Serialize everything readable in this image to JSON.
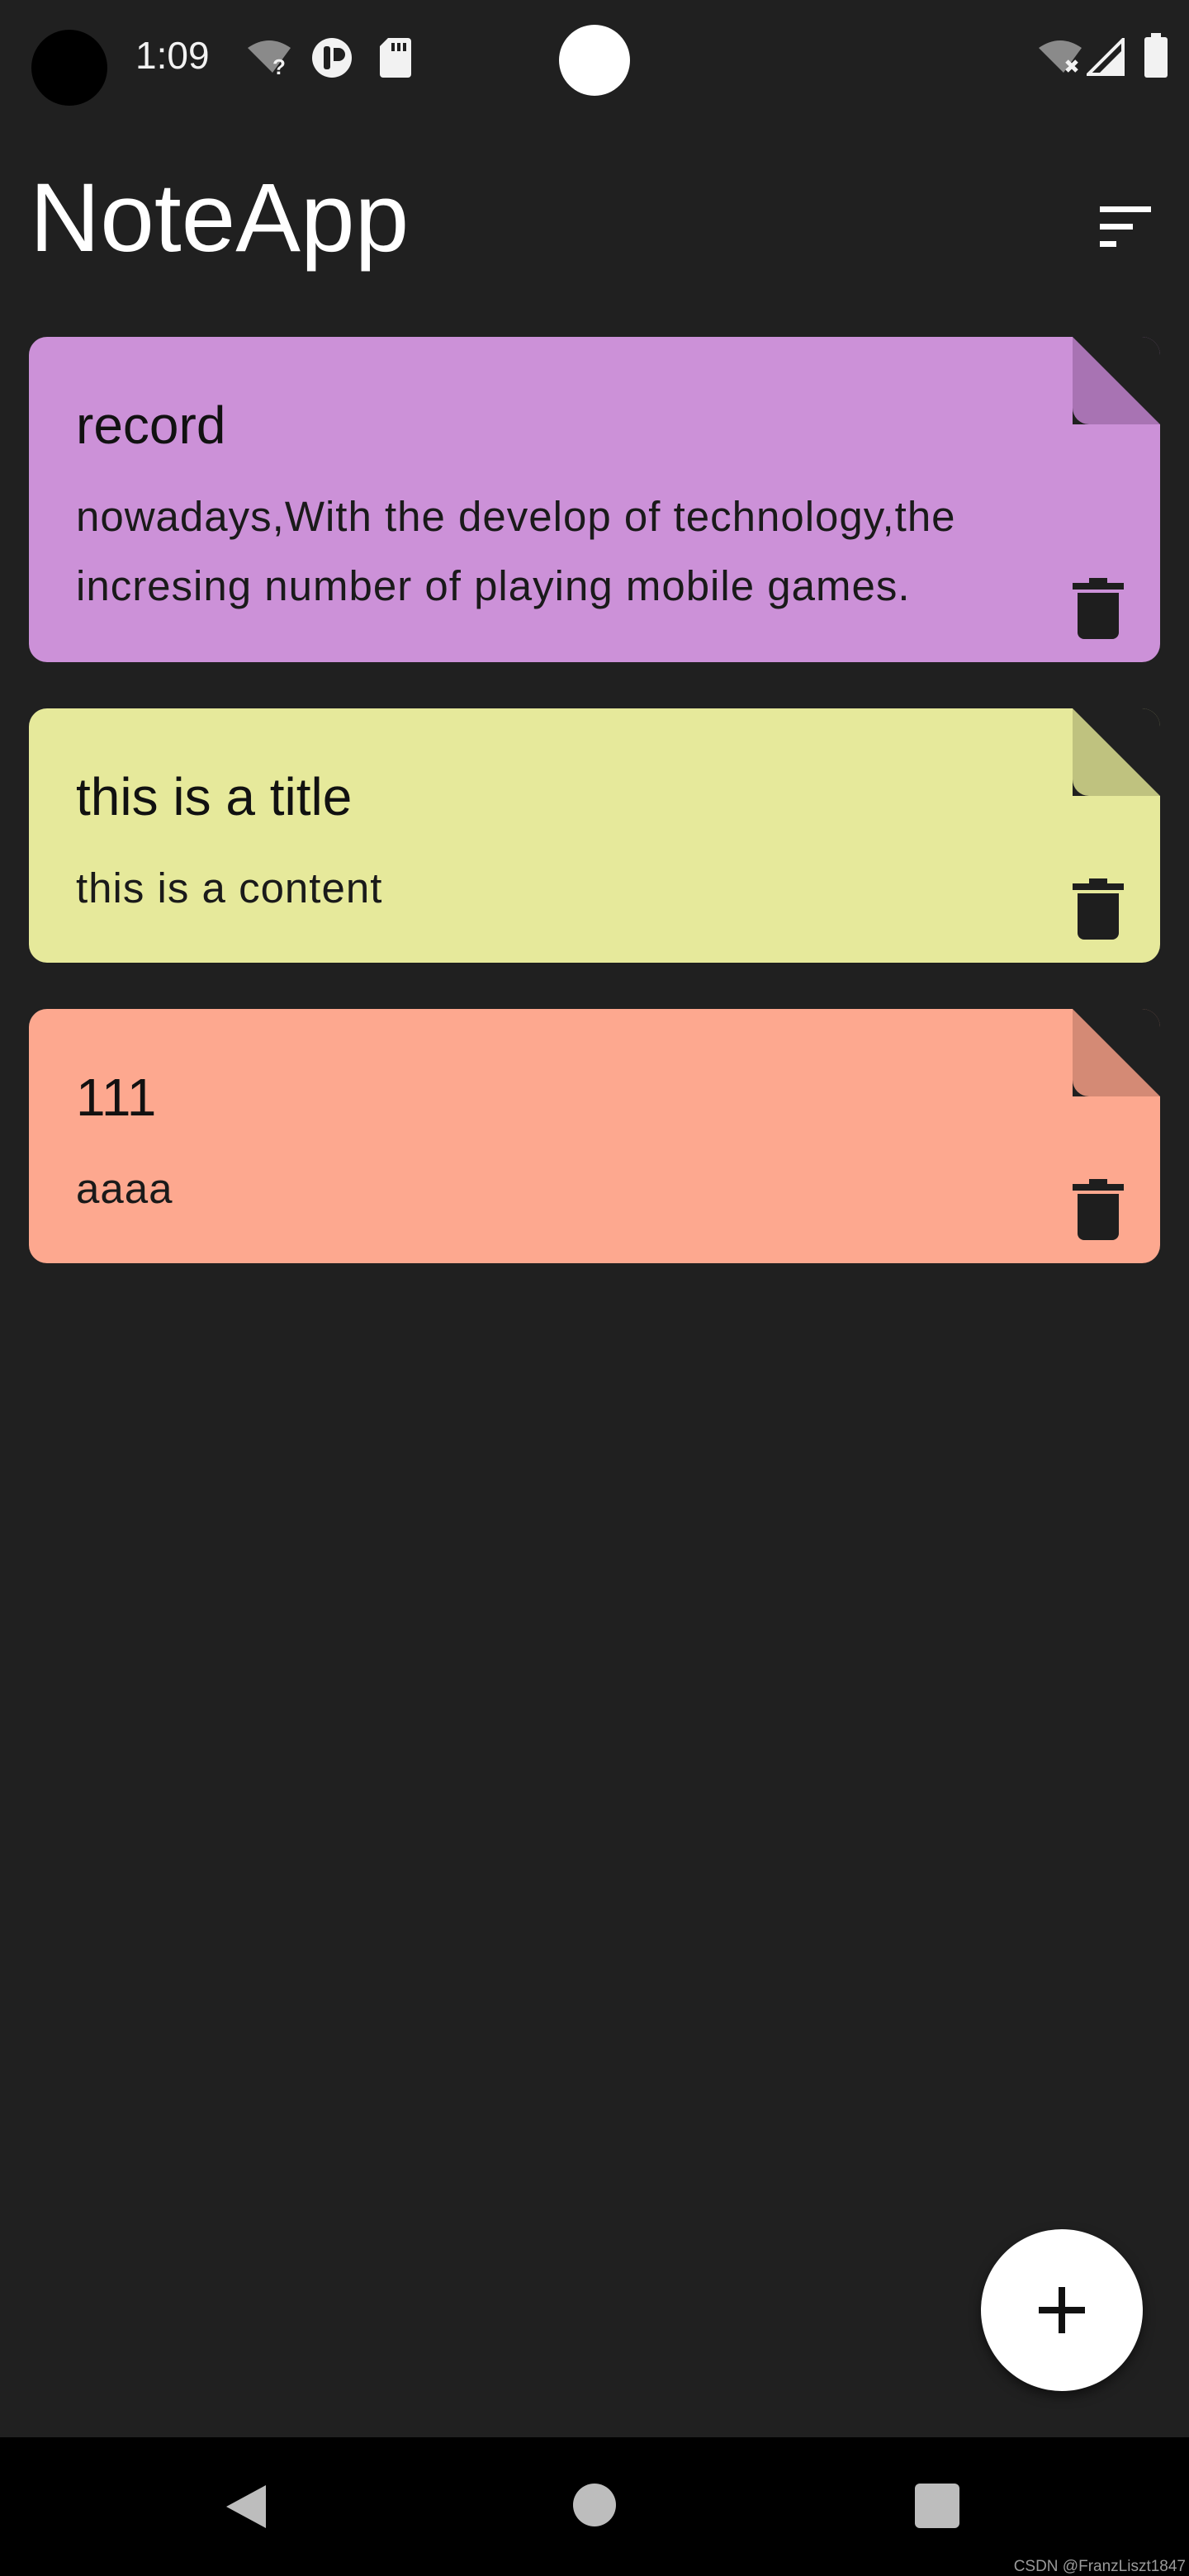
{
  "status_bar": {
    "time": "1:09"
  },
  "app": {
    "title": "NoteApp",
    "sort_icon": "sort-icon"
  },
  "notes": [
    {
      "title": "record",
      "content": "nowadays,With the develop of technology,the incresing number of playing mobile games.",
      "color": "#cc91d8",
      "fold_color": "#a873b3"
    },
    {
      "title": "this is a title",
      "content": "this is a content",
      "color": "#e6e99b",
      "fold_color": "#bfc27f"
    },
    {
      "title": "111",
      "content": "aaaa",
      "color": "#fda88f",
      "fold_color": "#d48a75"
    }
  ],
  "fab": {
    "icon": "plus-icon"
  },
  "nav": {
    "back_icon": "back-icon",
    "home_icon": "home-icon",
    "recents_icon": "recents-icon"
  },
  "watermark": "CSDN @FranzLiszt1847"
}
